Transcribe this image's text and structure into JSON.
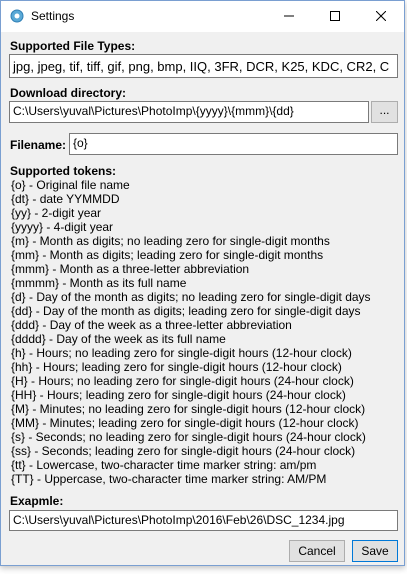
{
  "window": {
    "title": "Settings",
    "app_icon": "settings-gear-icon"
  },
  "file_types": {
    "label": "Supported File Types:",
    "value": "jpg, jpeg, tif, tiff, gif, png, bmp, IIQ, 3FR, DCR, K25, KDC, CR2, C"
  },
  "download_dir": {
    "label": "Download directory:",
    "value": "C:\\Users\\yuval\\Pictures\\PhotoImp\\{yyyy}\\{mmm}\\{dd}",
    "browse_label": "..."
  },
  "filename": {
    "label": "Filename:",
    "value": "{o}"
  },
  "tokens": {
    "title": "Supported tokens:",
    "lines": [
      "{o} - Original file name",
      "{dt} - date YYMMDD",
      "{yy} - 2-digit year",
      "{yyyy} - 4-digit year",
      "{m} - Month as digits; no leading zero for single-digit months",
      "{mm} - Month as digits; leading zero for single-digit months",
      "{mmm} - Month as a three-letter abbreviation",
      "{mmmm} - Month as its full name",
      "{d} - Day of the month as digits; no leading zero for single-digit days",
      "{dd} - Day of the month as digits; leading zero for single-digit days",
      "{ddd} - Day of the week as a three-letter abbreviation",
      "{dddd} - Day of the week as its full name",
      "{h} - Hours; no leading zero for single-digit hours (12-hour clock)",
      "{hh} - Hours; leading zero for single-digit hours (12-hour clock)",
      "{H} - Hours; no leading zero for single-digit hours (24-hour clock)",
      "{HH} - Hours; leading zero for single-digit hours (24-hour clock)",
      "{M} - Minutes; no leading zero for single-digit hours (12-hour clock)",
      "{MM} - Minutes; leading zero for single-digit hours (12-hour clock)",
      "{s} - Seconds; no leading zero for single-digit hours (24-hour clock)",
      "{ss} - Seconds; leading zero for single-digit hours (24-hour clock)",
      "{tt} - Lowercase, two-character time marker string: am/pm",
      "{TT} - Uppercase, two-character time marker string: AM/PM"
    ]
  },
  "example": {
    "label": "Exapmle:",
    "value": "C:\\Users\\yuval\\Pictures\\PhotoImp\\2016\\Feb\\26\\DSC_1234.jpg"
  },
  "buttons": {
    "cancel": "Cancel",
    "save": "Save"
  },
  "colors": {
    "accent": "#0078d7",
    "window_bg": "#f0f0f0"
  }
}
